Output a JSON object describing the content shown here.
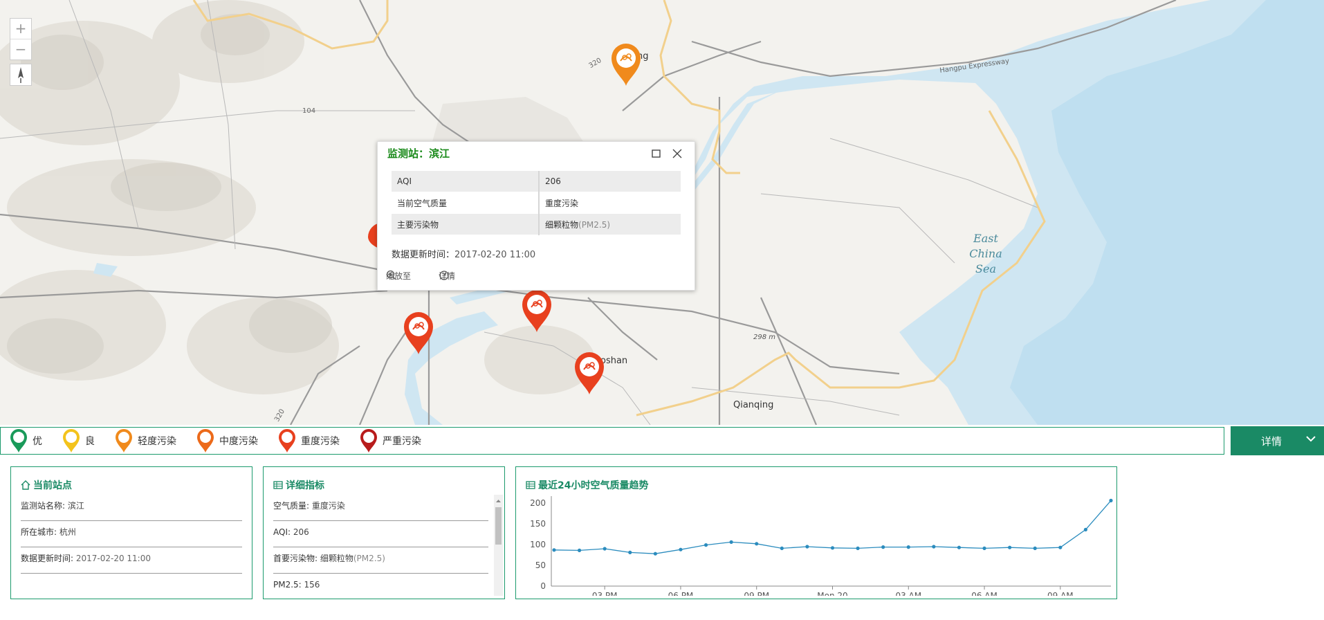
{
  "map": {
    "labels": {
      "place1": "ng",
      "place2": "oshan",
      "place3": "Qianqing",
      "road1": "320",
      "road2": "104",
      "road3": "320",
      "road4": "Hangpu Expressway",
      "road5": "298 m",
      "sea_line1": "East",
      "sea_line2": "China Sea"
    },
    "zoom_in": "+",
    "zoom_out": "−"
  },
  "popup": {
    "title": "监测站：滨江",
    "rows": [
      {
        "key": "AQI",
        "value": "206"
      },
      {
        "key": "当前空气质量",
        "value": "重度污染"
      },
      {
        "key": "主要污染物",
        "value": "细颗粒物",
        "value_suffix": "(PM2.5)"
      }
    ],
    "time_label": "数据更新时间：",
    "time_value": "2017-02-20 11:00",
    "zoom_action": "缩放至",
    "detail_action": "详情"
  },
  "legend": {
    "items": [
      {
        "label": "优",
        "color": "#1a9a5a"
      },
      {
        "label": "良",
        "color": "#f3c31c"
      },
      {
        "label": "轻度污染",
        "color": "#f08a1c"
      },
      {
        "label": "中度污染",
        "color": "#ec6a1a"
      },
      {
        "label": "重度污染",
        "color": "#e8401e"
      },
      {
        "label": "严重污染",
        "color": "#b81c1c"
      }
    ]
  },
  "detail_button": {
    "label": "详情"
  },
  "current_station": {
    "title": "当前站点",
    "rows": [
      {
        "label": "监测站名称: ",
        "value": "滨江"
      },
      {
        "label": "所在城市: ",
        "value": "杭州"
      },
      {
        "label": "数据更新时间: ",
        "value": "2017-02-20 11:00"
      }
    ]
  },
  "detail_indicators": {
    "title": "详细指标",
    "rows": [
      {
        "label": "空气质量: ",
        "value": "重度污染"
      },
      {
        "label": "AQI: ",
        "value": "206"
      },
      {
        "label": "首要污染物: ",
        "value": "细颗粒物",
        "suffix": "(PM2.5)"
      },
      {
        "label": "PM2.5: ",
        "value": "156"
      }
    ]
  },
  "trend": {
    "title": "最近24小时空气质量趋势"
  },
  "colors": {
    "accent": "#1a8a65",
    "marker_heavy": "#e8401e",
    "marker_light": "#f08a1c",
    "line": "#2b8cbe"
  },
  "chart_data": {
    "type": "line",
    "title": "最近24小时空气质量趋势",
    "xlabel": "",
    "ylabel": "",
    "ylim": [
      0,
      210
    ],
    "yticks": [
      "0",
      "50",
      "100",
      "150",
      "200"
    ],
    "xticks": [
      "03 PM",
      "06 PM",
      "09 PM",
      "Mon 20",
      "03 AM",
      "06 AM",
      "09 AM"
    ],
    "series": [
      {
        "values": [
          87,
          86,
          90,
          81,
          78,
          88,
          99,
          106,
          102,
          91,
          95,
          92,
          91,
          94,
          94,
          95,
          93,
          91,
          93,
          91,
          93,
          136,
          206
        ]
      }
    ],
    "grid": false
  }
}
